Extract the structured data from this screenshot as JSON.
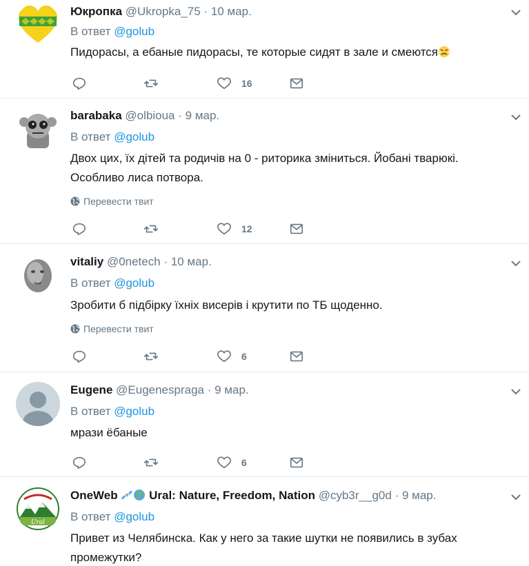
{
  "translate_label": "Перевести твит",
  "tweets": [
    {
      "name": "Юкропка",
      "handle": "@Ukropka_75",
      "dot": "·",
      "time": "10 мар.",
      "reply_prefix": "В ответ",
      "reply_to": "@golub",
      "text": "Пидорасы, а ебаные пидорасы, те  которые сидят в зале и смеются",
      "text_emoji": "angry-face-icon",
      "likes": "16"
    },
    {
      "name": "barabaka",
      "handle": "@olbioua",
      "dot": "·",
      "time": "9 мар.",
      "reply_prefix": "В ответ",
      "reply_to": "@golub",
      "text": "Двох цих, їх дітей та родичів на 0 - риторика зміниться. Йобані тварюкі. Особливо лиса потвора.",
      "likes": "12"
    },
    {
      "name": "vitaliy",
      "handle": "@0netech",
      "dot": "·",
      "time": "10 мар.",
      "reply_prefix": "В ответ",
      "reply_to": "@golub",
      "text": "Зробити б підбірку їхніх висерів і крутити по ТБ щоденно.",
      "likes": "6"
    },
    {
      "name": "Eugene",
      "handle": "@Eugenespraga",
      "dot": "·",
      "time": "9 мар.",
      "reply_prefix": "В ответ",
      "reply_to": "@golub",
      "text": "мрази ёбаные",
      "likes": "6"
    },
    {
      "name": "OneWeb",
      "name_rest": "Ural: Nature, Freedom, Nation",
      "handle": "@cyb3r__g0d",
      "dot": "·",
      "time": "9 мар.",
      "reply_prefix": "В ответ",
      "reply_to": "@golub",
      "text": "Привет из Челябинска. Как у него за такие шутки не появились в зубах промежутки?",
      "avatar_text": "Ural"
    }
  ],
  "colors": {
    "accent": "#1b95e0",
    "secondary": "#657786",
    "divider": "#e6ecf0",
    "text": "#14171a"
  }
}
